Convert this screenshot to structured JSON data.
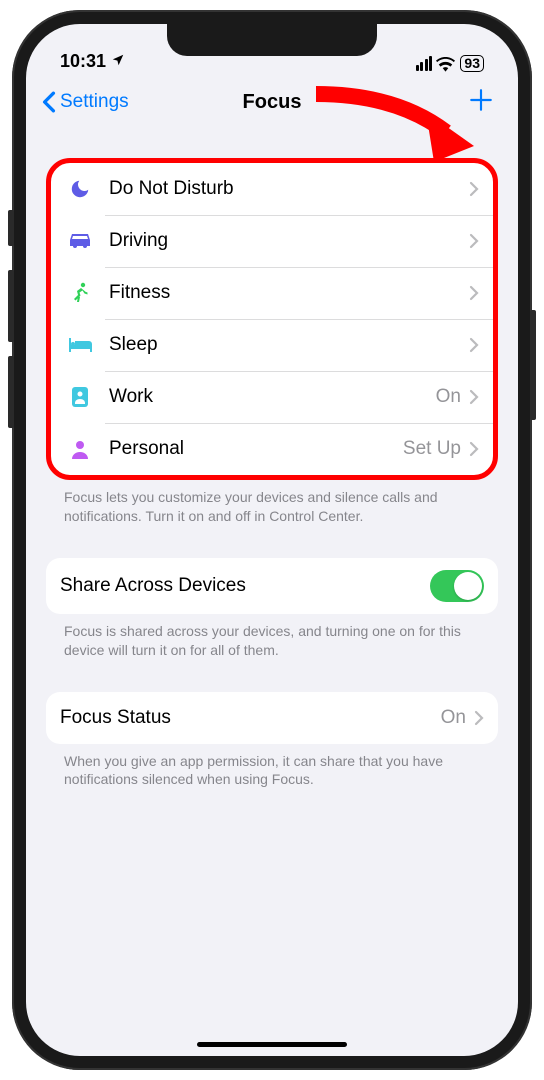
{
  "status": {
    "time": "10:31",
    "battery": "93"
  },
  "nav": {
    "back": "Settings",
    "title": "Focus"
  },
  "focus_list": [
    {
      "icon": "moon",
      "color": "#5e5ce6",
      "label": "Do Not Disturb",
      "detail": ""
    },
    {
      "icon": "car",
      "color": "#5e5ce6",
      "label": "Driving",
      "detail": ""
    },
    {
      "icon": "runner",
      "color": "#30d158",
      "label": "Fitness",
      "detail": ""
    },
    {
      "icon": "bed",
      "color": "#40c8e0",
      "label": "Sleep",
      "detail": ""
    },
    {
      "icon": "badge",
      "color": "#40c8e0",
      "label": "Work",
      "detail": "On"
    },
    {
      "icon": "person",
      "color": "#bf5af2",
      "label": "Personal",
      "detail": "Set Up"
    }
  ],
  "footer1": "Focus lets you customize your devices and silence calls and notifications. Turn it on and off in Control Center.",
  "share": {
    "label": "Share Across Devices",
    "on": true
  },
  "footer2": "Focus is shared across your devices, and turning one on for this device will turn it on for all of them.",
  "status_row": {
    "label": "Focus Status",
    "detail": "On"
  },
  "footer3": "When you give an app permission, it can share that you have notifications silenced when using Focus."
}
